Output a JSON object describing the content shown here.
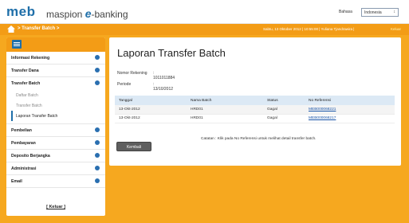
{
  "header": {
    "logo": "meb",
    "brand_prefix": "maspion ",
    "brand_e": "e",
    "brand_suffix": "-banking",
    "language_label": "Bahasa",
    "language_value": "Indonesia"
  },
  "navbar": {
    "breadcrumb": "> Transfer Batch >",
    "session_text": "Sabtu, 13 Oktober 2012 | 10:55:00 | Yuliana Tjandrawira |",
    "logout": "Keluar"
  },
  "sidebar": {
    "items": [
      {
        "label": "Informasi Rekening"
      },
      {
        "label": "Transfer Dana"
      },
      {
        "label": "Transfer Batch"
      }
    ],
    "sub_items": [
      {
        "label": "Daftar Batch"
      },
      {
        "label": "Transfer Batch"
      },
      {
        "label": "Laporan Transfer Batch"
      }
    ],
    "items_after": [
      {
        "label": "Pembelian"
      },
      {
        "label": "Pembayaran"
      },
      {
        "label": "Deposito Berjangka"
      },
      {
        "label": "Administrasi"
      },
      {
        "label": "Email"
      }
    ],
    "logout": "[ Keluar ]"
  },
  "main": {
    "title": "Laporan Transfer Batch",
    "account_label": "Nomor Rekening",
    "account_value": ": 1011011884",
    "period_label": "Periode",
    "period_value": ": 13/10/2012",
    "columns": [
      "Tanggal",
      "Nama Batch",
      "Status",
      "No Referensi"
    ],
    "rows": [
      [
        "13-Okt-2012",
        "HRD01",
        "Gagal",
        "MEB000068221"
      ],
      [
        "13-Okt-2012",
        "HRD01",
        "Gagal",
        "MEB000068217"
      ]
    ],
    "note": "Catatan : Klik pada No Referensi untuk melihat detail transfer batch.",
    "back_button": "Kembali"
  },
  "colors": {
    "accent": "#f39c16",
    "brand_blue": "#1f6fa9",
    "background": "#f6a81f"
  }
}
